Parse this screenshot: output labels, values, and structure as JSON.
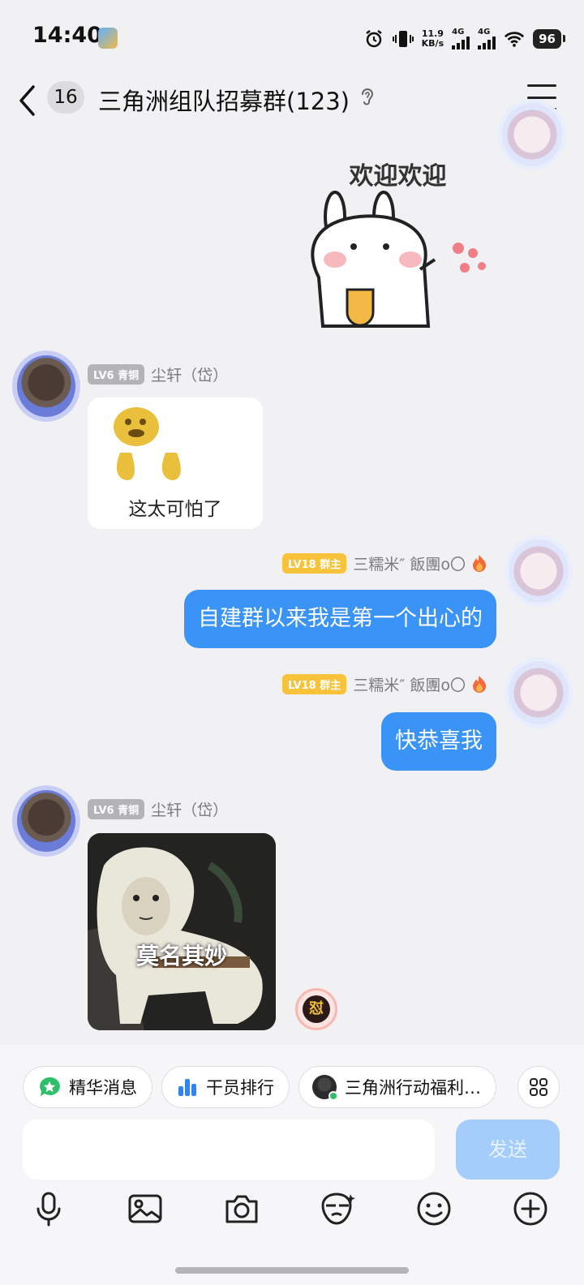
{
  "status_bar": {
    "time": "14:40",
    "net_speed_value": "11.9",
    "net_speed_unit": "KB/s",
    "sim1": "4G",
    "sim2": "4G",
    "battery": "96"
  },
  "header": {
    "unread_count": "16",
    "title": "三角洲组队招募群(123)"
  },
  "messages": [
    {
      "type": "sticker",
      "from": "self",
      "caption": "欢迎欢迎"
    },
    {
      "type": "sticker",
      "from": "other",
      "level": "LV6 青铜",
      "sender": "尘轩（岱）",
      "caption": "这太可怕了"
    },
    {
      "type": "text",
      "from": "self",
      "level": "LV18 群主",
      "sender": "三糯米″ 飯團o〇",
      "text": "自建群以来我是第一个出心的"
    },
    {
      "type": "text",
      "from": "self",
      "level": "LV18 群主",
      "sender": "三糯米″ 飯團o〇",
      "text": "快恭喜我"
    },
    {
      "type": "sticker",
      "from": "other",
      "level": "LV6 青铜",
      "sender": "尘轩（岱）",
      "caption": "莫名其妙",
      "reaction": "怼"
    }
  ],
  "quick_bar": [
    {
      "label": "精华消息",
      "icon": "star-bubble-icon"
    },
    {
      "label": "干员排行",
      "icon": "bar-chart-icon"
    },
    {
      "label": "三角洲行动福利…",
      "icon": "game-avatar-icon"
    }
  ],
  "composer": {
    "placeholder": "",
    "send_label": "发送"
  },
  "toolbar": [
    "microphone-icon",
    "image-icon",
    "camera-icon",
    "sticker-face-icon",
    "smiley-icon",
    "plus-icon"
  ],
  "colors": {
    "bubble_self": "#3a93f7",
    "owner_badge": "#f8c33a",
    "level_badge": "#b3b3b8",
    "send_disabled": "#a4cdfb",
    "background": "#f1f1f4"
  }
}
